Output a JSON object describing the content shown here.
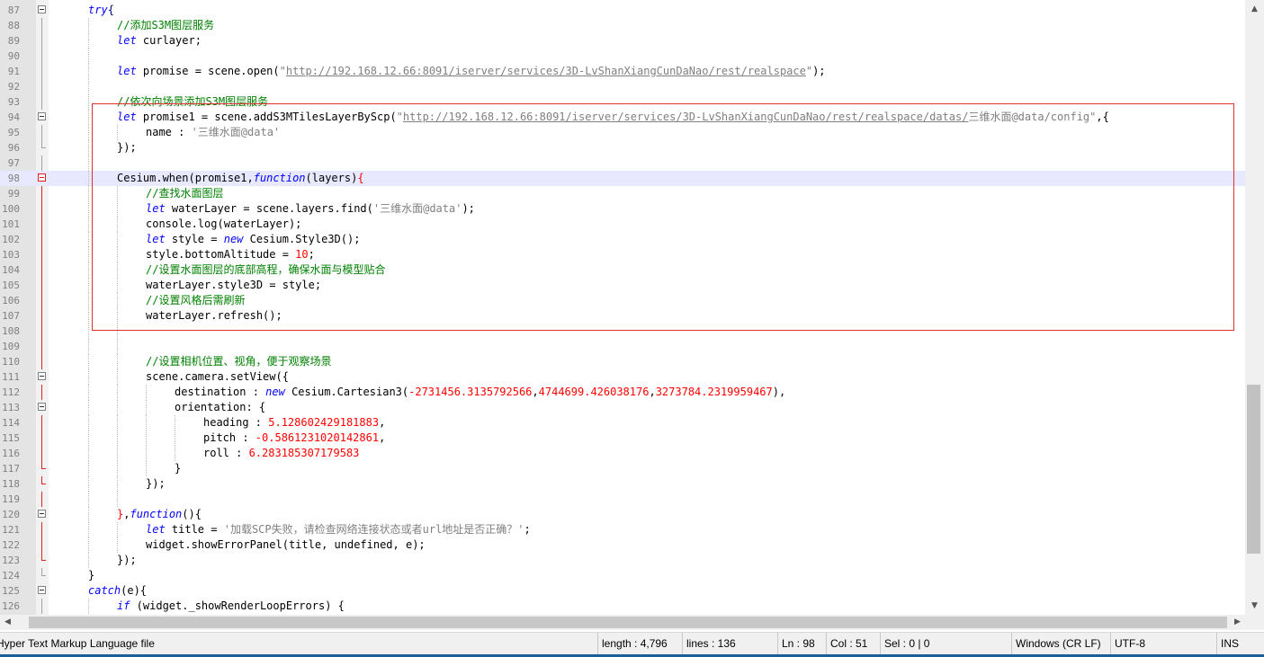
{
  "editor": {
    "current_line": 98,
    "lines": [
      {
        "n": 87,
        "indent": 1,
        "fold": "open",
        "tokens": [
          {
            "t": "kw",
            "v": "try"
          },
          {
            "t": "p",
            "v": "{"
          }
        ]
      },
      {
        "n": 88,
        "indent": 2,
        "fold": "line",
        "tokens": [
          {
            "t": "c",
            "v": "//添加S3M图层服务"
          }
        ]
      },
      {
        "n": 89,
        "indent": 2,
        "fold": "line",
        "tokens": [
          {
            "t": "kw",
            "v": "let"
          },
          {
            "t": "d",
            "v": " curlayer;"
          }
        ]
      },
      {
        "n": 90,
        "indent": 2,
        "fold": "line",
        "tokens": []
      },
      {
        "n": 91,
        "indent": 2,
        "fold": "line",
        "tokens": [
          {
            "t": "kw",
            "v": "let"
          },
          {
            "t": "d",
            "v": " promise = scene.open("
          },
          {
            "t": "s",
            "v": "\""
          },
          {
            "t": "u",
            "v": "http://192.168.12.66:8091/iserver/services/3D-LvShanXiangCunDaNao/rest/realspace"
          },
          {
            "t": "s",
            "v": "\""
          },
          {
            "t": "d",
            "v": ");"
          }
        ]
      },
      {
        "n": 92,
        "indent": 2,
        "fold": "line",
        "tokens": []
      },
      {
        "n": 93,
        "indent": 2,
        "fold": "line",
        "tokens": [
          {
            "t": "c",
            "v": "//依次向场景添加S3M图层服务"
          }
        ]
      },
      {
        "n": 94,
        "indent": 2,
        "fold": "open",
        "tokens": [
          {
            "t": "kw",
            "v": "let"
          },
          {
            "t": "d",
            "v": " promise1 = scene.addS3MTilesLayerByScp("
          },
          {
            "t": "s",
            "v": "\""
          },
          {
            "t": "u",
            "v": "http://192.168.12.66:8091/iserver/services/3D-LvShanXiangCunDaNao/rest/realspace/datas/"
          },
          {
            "t": "s",
            "v": "三维水面@data/config\""
          },
          {
            "t": "d",
            "v": ",{"
          }
        ]
      },
      {
        "n": 95,
        "indent": 3,
        "fold": "line",
        "tokens": [
          {
            "t": "d",
            "v": "name : "
          },
          {
            "t": "s",
            "v": "'三维水面@data'"
          }
        ]
      },
      {
        "n": 96,
        "indent": 2,
        "fold": "end",
        "tokens": [
          {
            "t": "d",
            "v": "});"
          }
        ]
      },
      {
        "n": 97,
        "indent": 2,
        "fold": "line",
        "tokens": []
      },
      {
        "n": 98,
        "indent": 2,
        "fold": "open-red",
        "tokens": [
          {
            "t": "d",
            "v": "Cesium.when(promise1,"
          },
          {
            "t": "kw",
            "v": "function"
          },
          {
            "t": "d",
            "v": "(layers)"
          },
          {
            "t": "b",
            "v": "{"
          }
        ]
      },
      {
        "n": 99,
        "indent": 3,
        "fold": "line-red",
        "tokens": [
          {
            "t": "c",
            "v": "//查找水面图层"
          }
        ]
      },
      {
        "n": 100,
        "indent": 3,
        "fold": "line-red",
        "tokens": [
          {
            "t": "kw",
            "v": "let"
          },
          {
            "t": "d",
            "v": " waterLayer = scene.layers.find("
          },
          {
            "t": "s",
            "v": "'三维水面@data'"
          },
          {
            "t": "d",
            "v": ");"
          }
        ]
      },
      {
        "n": 101,
        "indent": 3,
        "fold": "line-red",
        "tokens": [
          {
            "t": "d",
            "v": "console.log(waterLayer);"
          }
        ]
      },
      {
        "n": 102,
        "indent": 3,
        "fold": "line-red",
        "tokens": [
          {
            "t": "kw",
            "v": "let"
          },
          {
            "t": "d",
            "v": " style = "
          },
          {
            "t": "kw",
            "v": "new"
          },
          {
            "t": "d",
            "v": " Cesium.Style3D();"
          }
        ]
      },
      {
        "n": 103,
        "indent": 3,
        "fold": "line-red",
        "tokens": [
          {
            "t": "d",
            "v": "style.bottomAltitude = "
          },
          {
            "t": "n",
            "v": "10"
          },
          {
            "t": "d",
            "v": ";"
          }
        ]
      },
      {
        "n": 104,
        "indent": 3,
        "fold": "line-red",
        "tokens": [
          {
            "t": "c",
            "v": "//设置水面图层的底部高程，确保水面与模型贴合"
          }
        ]
      },
      {
        "n": 105,
        "indent": 3,
        "fold": "line-red",
        "tokens": [
          {
            "t": "d",
            "v": "waterLayer.style3D = style;"
          }
        ]
      },
      {
        "n": 106,
        "indent": 3,
        "fold": "line-red",
        "tokens": [
          {
            "t": "c",
            "v": "//设置风格后需刷新"
          }
        ]
      },
      {
        "n": 107,
        "indent": 3,
        "fold": "line-red",
        "tokens": [
          {
            "t": "d",
            "v": "waterLayer.refresh();"
          }
        ]
      },
      {
        "n": 108,
        "indent": 3,
        "fold": "line-red",
        "tokens": []
      },
      {
        "n": 109,
        "indent": 3,
        "fold": "line-red",
        "tokens": []
      },
      {
        "n": 110,
        "indent": 3,
        "fold": "line-red",
        "tokens": [
          {
            "t": "c",
            "v": "//设置相机位置、视角，便于观察场景"
          }
        ]
      },
      {
        "n": 111,
        "indent": 3,
        "fold": "open",
        "tokens": [
          {
            "t": "d",
            "v": "scene.camera.setView({"
          }
        ]
      },
      {
        "n": 112,
        "indent": 4,
        "fold": "line-red",
        "tokens": [
          {
            "t": "d",
            "v": "destination : "
          },
          {
            "t": "kw",
            "v": "new"
          },
          {
            "t": "d",
            "v": " Cesium.Cartesian3("
          },
          {
            "t": "n",
            "v": "-2731456.3135792566"
          },
          {
            "t": "d",
            "v": ","
          },
          {
            "t": "n",
            "v": "4744699.426038176"
          },
          {
            "t": "d",
            "v": ","
          },
          {
            "t": "n",
            "v": "3273784.2319959467"
          },
          {
            "t": "d",
            "v": "),"
          }
        ]
      },
      {
        "n": 113,
        "indent": 4,
        "fold": "open",
        "tokens": [
          {
            "t": "d",
            "v": "orientation: {"
          }
        ]
      },
      {
        "n": 114,
        "indent": 5,
        "fold": "line-red",
        "tokens": [
          {
            "t": "d",
            "v": "heading : "
          },
          {
            "t": "n",
            "v": "5.128602429181883"
          },
          {
            "t": "d",
            "v": ","
          }
        ]
      },
      {
        "n": 115,
        "indent": 5,
        "fold": "line-red",
        "tokens": [
          {
            "t": "d",
            "v": "pitch : "
          },
          {
            "t": "n",
            "v": "-0.5861231020142861"
          },
          {
            "t": "d",
            "v": ","
          }
        ]
      },
      {
        "n": 116,
        "indent": 5,
        "fold": "line-red",
        "tokens": [
          {
            "t": "d",
            "v": "roll : "
          },
          {
            "t": "n",
            "v": "6.283185307179583"
          }
        ]
      },
      {
        "n": 117,
        "indent": 4,
        "fold": "end-red",
        "tokens": [
          {
            "t": "d",
            "v": "}"
          }
        ]
      },
      {
        "n": 118,
        "indent": 3,
        "fold": "end-red",
        "tokens": [
          {
            "t": "d",
            "v": "});"
          }
        ]
      },
      {
        "n": 119,
        "indent": 3,
        "fold": "line-red",
        "tokens": []
      },
      {
        "n": 120,
        "indent": 2,
        "fold": "open",
        "tokens": [
          {
            "t": "b",
            "v": "}"
          },
          {
            "t": "d",
            "v": ","
          },
          {
            "t": "kw",
            "v": "function"
          },
          {
            "t": "d",
            "v": "(){"
          }
        ]
      },
      {
        "n": 121,
        "indent": 3,
        "fold": "line-red",
        "tokens": [
          {
            "t": "kw",
            "v": "let"
          },
          {
            "t": "d",
            "v": " title = "
          },
          {
            "t": "s",
            "v": "'加载SCP失败，请检查网络连接状态或者url地址是否正确？'"
          },
          {
            "t": "d",
            "v": ";"
          }
        ]
      },
      {
        "n": 122,
        "indent": 3,
        "fold": "line-red",
        "tokens": [
          {
            "t": "d",
            "v": "widget.showErrorPanel(title, undefined, e);"
          }
        ]
      },
      {
        "n": 123,
        "indent": 2,
        "fold": "end-red",
        "tokens": [
          {
            "t": "d",
            "v": "});"
          }
        ]
      },
      {
        "n": 124,
        "indent": 1,
        "fold": "end",
        "tokens": [
          {
            "t": "d",
            "v": "}"
          }
        ]
      },
      {
        "n": 125,
        "indent": 1,
        "fold": "open",
        "tokens": [
          {
            "t": "kw",
            "v": "catch"
          },
          {
            "t": "d",
            "v": "(e){"
          }
        ]
      },
      {
        "n": 126,
        "indent": 2,
        "fold": "line",
        "tokens": [
          {
            "t": "kw",
            "v": "if"
          },
          {
            "t": "d",
            "v": " (widget._showRenderLoopErrors) {"
          }
        ]
      }
    ]
  },
  "scrollbars": {
    "up_icon": "▲",
    "down_icon": "▼",
    "left_icon": "◀",
    "right_icon": "▶"
  },
  "statusbar": {
    "file_type": "Hyper Text Markup Language file",
    "length": "length : 4,796",
    "lines": "lines : 136",
    "ln": "Ln : 98",
    "col": "Col : 51",
    "sel": "Sel : 0 | 0",
    "eol": "Windows (CR LF)",
    "encoding": "UTF-8",
    "mode": "INS"
  },
  "colors": {
    "keyword": "#0000ff",
    "comment": "#008000",
    "string": "#808080",
    "number": "#ff0000",
    "highlight_box": "#e03030",
    "current_line": "#e8e8ff"
  }
}
